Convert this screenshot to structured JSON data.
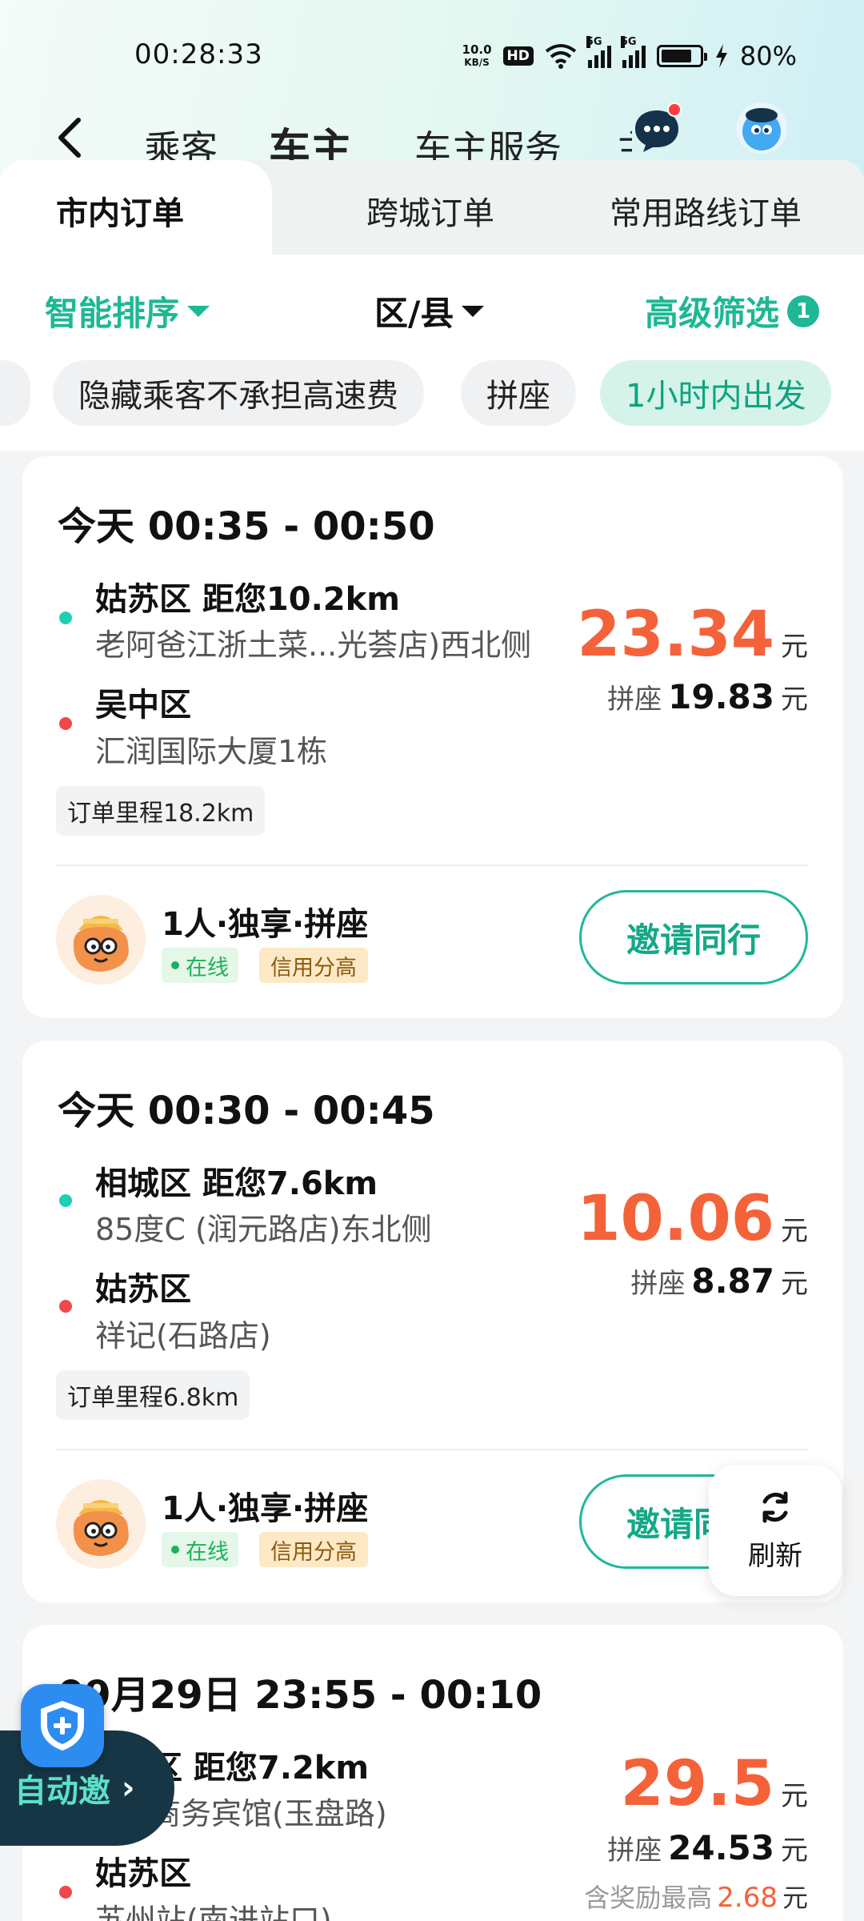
{
  "status_bar": {
    "time": "00:28:33",
    "net_speed_value": "10.0",
    "net_speed_unit": "KB/S",
    "hd_label": "HD",
    "signal_5g_label": "5G",
    "battery_percent": "80%"
  },
  "nav": {
    "tabs": [
      "乘客",
      "车主",
      "车主服务"
    ],
    "active_tab": "车主",
    "overflow_char": "主"
  },
  "subtabs": {
    "items": [
      "市内订单",
      "跨城订单",
      "常用路线订单"
    ],
    "active": "市内订单"
  },
  "filters": {
    "sort_label": "智能排序",
    "district_label": "区/县",
    "advanced_label": "高级筛选",
    "advanced_count": "1",
    "chips": [
      "隐藏乘客不承担高速费",
      "拼座",
      "1小时内出发"
    ],
    "chip_active": "1小时内出发"
  },
  "orders": [
    {
      "time": "今天 00:35 - 00:50",
      "from_title": "姑苏区 距您10.2km",
      "from_addr": "老阿爸江浙土菜...光荟店)西北侧",
      "to_title": "吴中区",
      "to_addr": "汇润国际大厦1栋",
      "mileage": "订单里程18.2km",
      "price": "23.34",
      "price_unit": "元",
      "share_label": "拼座",
      "share_price": "19.83",
      "passenger_type": "1人·独享·拼座",
      "tag_online": "在线",
      "tag_credit": "信用分高",
      "invite_label": "邀请同行"
    },
    {
      "time": "今天 00:30 - 00:45",
      "from_title": "相城区 距您7.6km",
      "from_addr": "85度C (润元路店)东北侧",
      "to_title": "姑苏区",
      "to_addr": "祥记(石路店)",
      "mileage": "订单里程6.8km",
      "price": "10.06",
      "price_unit": "元",
      "share_label": "拼座",
      "share_price": "8.87",
      "passenger_type": "1人·独享·拼座",
      "tag_online": "在线",
      "tag_credit": "信用分高",
      "invite_label": "邀请同"
    },
    {
      "time": "09月29日 23:55 - 00:10",
      "from_title": "区 距您7.2km",
      "from_addr": "商务宾馆(玉盘路)",
      "to_title": "姑苏区",
      "to_addr": "苏州站(南进站口)",
      "price": "29.5",
      "price_unit": "元",
      "share_label": "拼座",
      "share_price": "24.53",
      "bonus_label": "含奖励最高",
      "bonus_value": "2.68"
    }
  ],
  "floating": {
    "refresh_label": "刷新",
    "auto_invite_label": "自动邀",
    "auto_invite_chevron": "›"
  },
  "colors": {
    "accent_green": "#1db894",
    "price_orange": "#f4623a",
    "start_dot": "#1fcfb4",
    "end_dot": "#f04848"
  },
  "icons": [
    "back-arrow-icon",
    "message-bubble-icon",
    "user-avatar-icon",
    "sort-caret-icon",
    "refresh-icon",
    "shield-plus-icon"
  ]
}
